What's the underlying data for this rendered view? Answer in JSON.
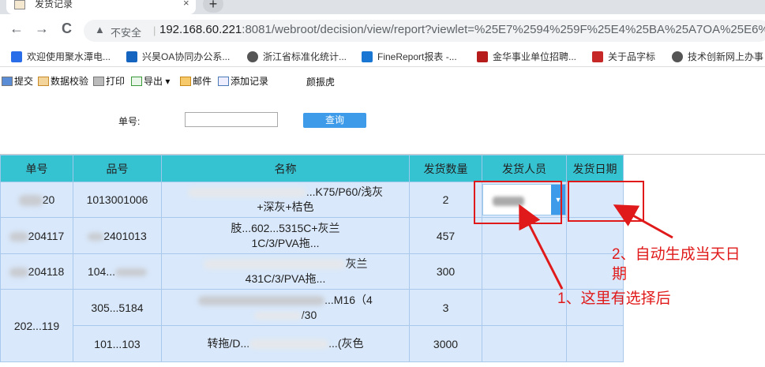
{
  "browser": {
    "tab_title": "发货记录",
    "tab_close": "×",
    "new_tab": "+",
    "back": "←",
    "forward": "→",
    "reload": "C",
    "warning": "▲",
    "not_secure": "不安全",
    "separator": "|",
    "url_host": "192.168.60.221",
    "url_rest": ":8081/webroot/decision/view/report?viewlet=%25E7%2594%259F%25E4%25BA%25A7OA%25E6%2"
  },
  "bookmarks": [
    {
      "label": "欢迎使用聚水潭电...",
      "color": "#2a6de8"
    },
    {
      "label": "兴昊OA协同办公系...",
      "color": "#1565c0"
    },
    {
      "label": "浙江省标准化统计...",
      "color": "#555555"
    },
    {
      "label": "FineReport报表 -...",
      "color": "#1976d2"
    },
    {
      "label": "金华事业单位招聘...",
      "color": "#b71c1c"
    },
    {
      "label": "关于品字标",
      "color": "#c62828"
    },
    {
      "label": "技术创新网上办事",
      "color": "#555555"
    }
  ],
  "toolbar": {
    "submit": "提交",
    "validate": "数据校验",
    "print": "打印",
    "export": "导出",
    "export_caret": "▾",
    "mail": "邮件",
    "add_record": "添加记录",
    "user": "颜振虎"
  },
  "form": {
    "order_label": "单号:",
    "order_value": "",
    "query_button": "查询"
  },
  "table": {
    "headers": [
      "单号",
      "品号",
      "名称",
      "发货数量",
      "发货人员",
      "发货日期"
    ],
    "rows": [
      {
        "order": "20",
        "product": "1013001006",
        "name_line1": "...K75/P60/浅灰",
        "name_line2": "+深灰+桔色",
        "qty": "2"
      },
      {
        "order": "204117",
        "product": "2401013",
        "name_line1": "肢...602...5315C+灰兰",
        "name_line2": "1C/3/PVA拖...",
        "qty": "457"
      },
      {
        "order": "204118",
        "product": "104...",
        "name_line1": "灰兰",
        "name_line2": "431C/3/PVA拖...",
        "qty": "300"
      },
      {
        "order": "202...119",
        "product": "305...5184",
        "name_line1": "...M16（4",
        "name_line2": "/30",
        "qty": "3"
      },
      {
        "order": "",
        "product": "101...103",
        "name_line1": "转拖/D...",
        "name_line2": "...(灰色",
        "qty": "3000"
      }
    ],
    "dropdown_arrow": "▼"
  },
  "annotations": {
    "note1": "1、这里有选择后",
    "note2_line1": "2、自动生成当天日",
    "note2_line2": "期",
    "color": "#e01a1a"
  }
}
